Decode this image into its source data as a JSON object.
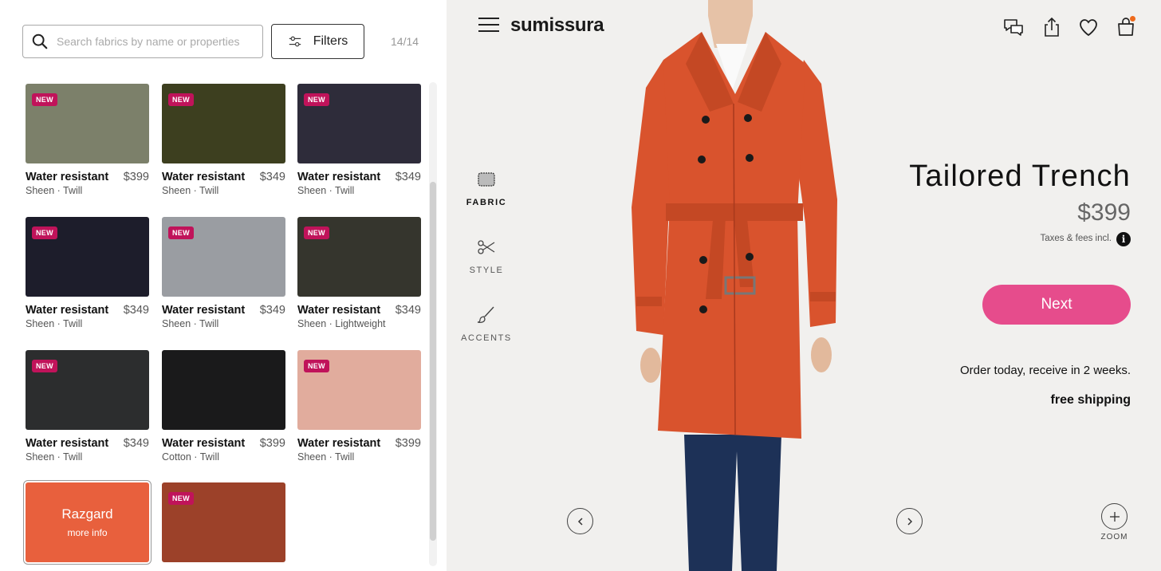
{
  "search": {
    "placeholder": "Search fabrics by name or properties"
  },
  "filters": {
    "label": "Filters"
  },
  "result_count": "14/14",
  "fabrics": [
    {
      "badge": "NEW",
      "name": "Water resistant",
      "price": "$399",
      "desc": "Sheen · Twill",
      "color": "#7c806a"
    },
    {
      "badge": "NEW",
      "name": "Water resistant",
      "price": "$349",
      "desc": "Sheen · Twill",
      "color": "#3d3f1f"
    },
    {
      "badge": "NEW",
      "name": "Water resistant",
      "price": "$349",
      "desc": "Sheen · Twill",
      "color": "#2e2c3a"
    },
    {
      "badge": "NEW",
      "name": "Water resistant",
      "price": "$349",
      "desc": "Sheen · Twill",
      "color": "#1d1d2b"
    },
    {
      "badge": "NEW",
      "name": "Water resistant",
      "price": "$349",
      "desc": "Sheen · Twill",
      "color": "#9a9da2"
    },
    {
      "badge": "NEW",
      "name": "Water resistant",
      "price": "$349",
      "desc": "Sheen · Lightweight",
      "color": "#35352d"
    },
    {
      "badge": "NEW",
      "name": "Water resistant",
      "price": "$349",
      "desc": "Sheen · Twill",
      "color": "#2c2d2e"
    },
    {
      "badge": "",
      "name": "Water resistant",
      "price": "$399",
      "desc": "Cotton · Twill",
      "color": "#1a1a1b"
    },
    {
      "badge": "NEW",
      "name": "Water resistant",
      "price": "$399",
      "desc": "Sheen · Twill",
      "color": "#e1ac9d"
    },
    {
      "badge": "",
      "name": "",
      "price": "",
      "desc": "",
      "color": "#e8603d",
      "overlay_title": "Razgard",
      "overlay_sub": "more info",
      "selected": true
    },
    {
      "badge": "NEW",
      "name": "",
      "price": "",
      "desc": "",
      "color": "#9c4129"
    }
  ],
  "header": {
    "logo": "sumissura"
  },
  "icons": {
    "menu": "hamburger-icon",
    "chat": "chat-icon",
    "share": "share-icon",
    "favorite": "heart-icon",
    "cart": "shopping-bag-icon"
  },
  "side_tabs": [
    {
      "label": "FABRIC",
      "icon": "fabric-swatch-icon",
      "active": true
    },
    {
      "label": "STYLE",
      "icon": "scissors-icon",
      "active": false
    },
    {
      "label": "ACCENTS",
      "icon": "brush-icon",
      "active": false
    }
  ],
  "product": {
    "title": "Tailored Trench",
    "price": "$399",
    "taxes": "Taxes & fees incl.",
    "info": "i",
    "next_label": "Next",
    "delivery": "Order today, receive in 2 weeks.",
    "shipping": "free shipping",
    "coat_color": "#d9532d"
  },
  "viewer": {
    "zoom_label": "ZOOM"
  },
  "colors": {
    "accent": "#e64c8c",
    "badge": "#c0135a"
  }
}
